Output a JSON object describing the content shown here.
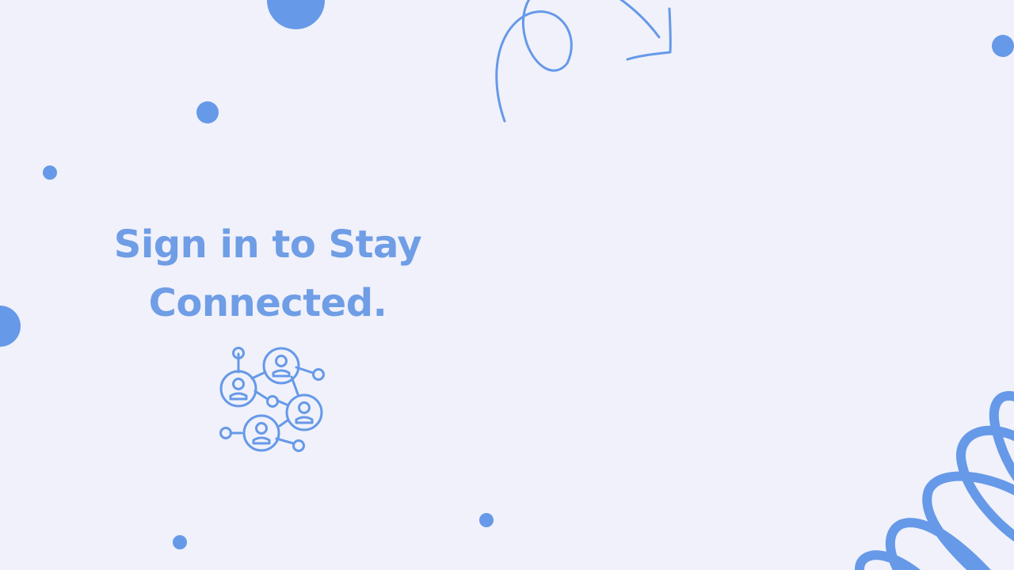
{
  "hero": {
    "title_line1": "Sign in to Stay",
    "title_line2": "Connected."
  },
  "icons": {
    "network": "people-network-icon",
    "arrow": "curved-arrow-icon",
    "spiral": "spiral-coil-icon"
  },
  "colors": {
    "background": "#f0f1fa",
    "accent": "#6699e8",
    "title": "#6f9de6"
  }
}
